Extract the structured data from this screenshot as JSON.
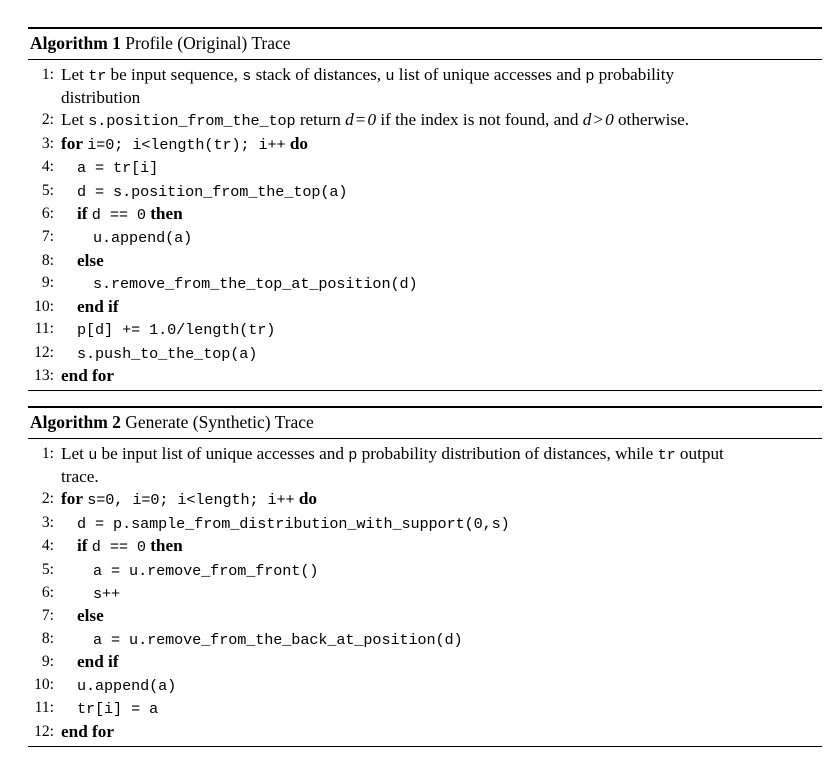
{
  "document": {
    "type": "algorithm-float",
    "count": 2
  },
  "algorithms": [
    {
      "id": "algorithm-1",
      "keyword": "Algorithm 1",
      "caption": "Profile (Original) Trace",
      "lines": [
        {
          "no": "1:",
          "indent": 0,
          "wrap": true,
          "text": "Let tr be input sequence, s stack of distances, u list of unique accesses and p probability",
          "text_cont": "distribution"
        },
        {
          "no": "2:",
          "indent": 0,
          "wrap": false,
          "text": "Let s.position_from_the_top return d = 0 if the index is not found, and d > 0 otherwise."
        },
        {
          "no": "3:",
          "indent": 0,
          "wrap": false,
          "text": "for i=0; i<length(tr); i++ do"
        },
        {
          "no": "4:",
          "indent": 1,
          "wrap": false,
          "text": "a = tr[i]"
        },
        {
          "no": "5:",
          "indent": 1,
          "wrap": false,
          "text": "d = s.position_from_the_top(a)"
        },
        {
          "no": "6:",
          "indent": 1,
          "wrap": false,
          "text": "if d == 0 then"
        },
        {
          "no": "7:",
          "indent": 2,
          "wrap": false,
          "text": "u.append(a)"
        },
        {
          "no": "8:",
          "indent": 1,
          "wrap": false,
          "text": "else"
        },
        {
          "no": "9:",
          "indent": 2,
          "wrap": false,
          "text": "s.remove_from_the_top_at_position(d)"
        },
        {
          "no": "10:",
          "indent": 1,
          "wrap": false,
          "text": "end if"
        },
        {
          "no": "11:",
          "indent": 1,
          "wrap": false,
          "text": "p[d] += 1.0/length(tr)"
        },
        {
          "no": "12:",
          "indent": 1,
          "wrap": false,
          "text": "s.push_to_the_top(a)"
        },
        {
          "no": "13:",
          "indent": 0,
          "wrap": false,
          "text": "end for"
        }
      ]
    },
    {
      "id": "algorithm-2",
      "keyword": "Algorithm 2",
      "caption": "Generate (Synthetic) Trace",
      "lines": [
        {
          "no": "1:",
          "indent": 0,
          "wrap": true,
          "text": "Let u be input list of unique accesses and p probability distribution of distances, while tr output",
          "text_cont": "trace."
        },
        {
          "no": "2:",
          "indent": 0,
          "wrap": false,
          "text": "for s=0, i=0; i<length; i++ do"
        },
        {
          "no": "3:",
          "indent": 1,
          "wrap": false,
          "text": "d = p.sample_from_distribution_with_support(0,s)"
        },
        {
          "no": "4:",
          "indent": 1,
          "wrap": false,
          "text": "if d == 0 then"
        },
        {
          "no": "5:",
          "indent": 2,
          "wrap": false,
          "text": "a = u.remove_from_front()"
        },
        {
          "no": "6:",
          "indent": 2,
          "wrap": false,
          "text": "s++"
        },
        {
          "no": "7:",
          "indent": 1,
          "wrap": false,
          "text": "else"
        },
        {
          "no": "8:",
          "indent": 2,
          "wrap": false,
          "text": "a = u.remove_from_the_back_at_position(d)"
        },
        {
          "no": "9:",
          "indent": 1,
          "wrap": false,
          "text": "end if"
        },
        {
          "no": "10:",
          "indent": 1,
          "wrap": false,
          "text": "u.append(a)"
        },
        {
          "no": "11:",
          "indent": 1,
          "wrap": false,
          "text": "tr[i] = a"
        },
        {
          "no": "12:",
          "indent": 0,
          "wrap": false,
          "text": "end for"
        }
      ]
    }
  ],
  "colors": {
    "text": "#000000",
    "background": "#ffffff",
    "rule": "#000000"
  }
}
